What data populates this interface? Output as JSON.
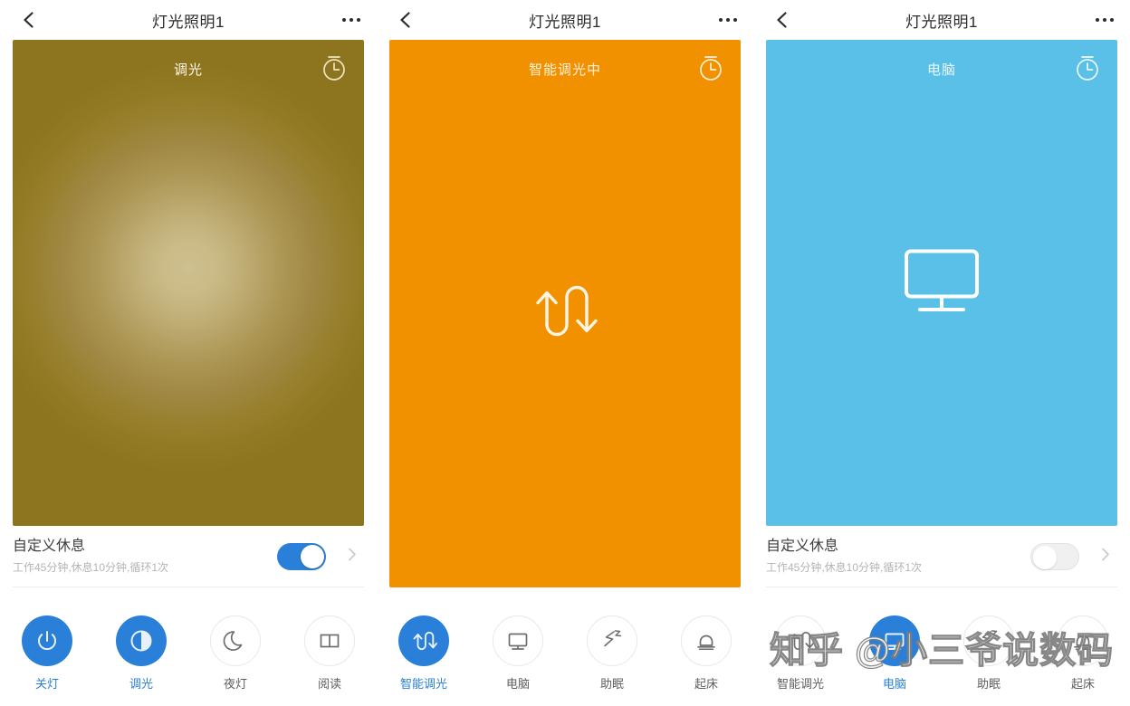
{
  "nav": {
    "back_icon": "chevron-left-icon",
    "title": "灯光照明1",
    "more_icon": "more-dots-icon"
  },
  "screens": [
    {
      "id": "dimming",
      "stage": {
        "label": "调光",
        "mode": "gradient-gold",
        "timer_icon": "timer-clock-icon",
        "center_icon": null
      },
      "rest": {
        "title": "自定义休息",
        "subtitle": "工作45分钟,休息10分钟,循环1次",
        "toggle_state": "on",
        "chevron_icon": "chevron-right-icon"
      },
      "scenes": [
        {
          "label": "关灯",
          "icon": "power-icon",
          "active": true
        },
        {
          "label": "调光",
          "icon": "contrast-icon",
          "active": true
        },
        {
          "label": "夜灯",
          "icon": "moon-icon",
          "active": false
        },
        {
          "label": "阅读",
          "icon": "book-icon",
          "active": false
        }
      ]
    },
    {
      "id": "smart-dimming",
      "stage": {
        "label": "智能调光中",
        "mode": "solid-orange",
        "timer_icon": "timer-clock-icon",
        "center_icon": "smart-dimming-flow-icon"
      },
      "rest": null,
      "scenes": [
        {
          "label": "智能调光",
          "icon": "smart-dimming-flow-icon",
          "active": true
        },
        {
          "label": "电脑",
          "icon": "monitor-icon",
          "active": false
        },
        {
          "label": "助眠",
          "icon": "sleep-zzz-icon",
          "active": false
        },
        {
          "label": "起床",
          "icon": "bell-icon",
          "active": false
        }
      ]
    },
    {
      "id": "computer",
      "stage": {
        "label": "电脑",
        "mode": "solid-blue",
        "timer_icon": "timer-clock-icon",
        "center_icon": "monitor-icon"
      },
      "rest": {
        "title": "自定义休息",
        "subtitle": "工作45分钟,休息10分钟,循环1次",
        "toggle_state": "off",
        "chevron_icon": "chevron-right-icon"
      },
      "scenes": [
        {
          "label": "智能调光",
          "icon": "smart-dimming-flow-icon",
          "active": false
        },
        {
          "label": "电脑",
          "icon": "monitor-icon",
          "active": true
        },
        {
          "label": "助眠",
          "icon": "sleep-zzz-icon",
          "active": false
        },
        {
          "label": "起床",
          "icon": "bell-icon",
          "active": false
        }
      ]
    }
  ],
  "watermark": {
    "text": "知乎 @小三爷说数码"
  },
  "colors": {
    "accent_blue": "#2a80d8",
    "orange": "#f29100",
    "sky_blue": "#5bc0e8",
    "gold_center": "#cec08f",
    "gold_edge": "#8d7520",
    "title_text": "#2b2b2b",
    "sub_text": "#b4b4b4"
  }
}
